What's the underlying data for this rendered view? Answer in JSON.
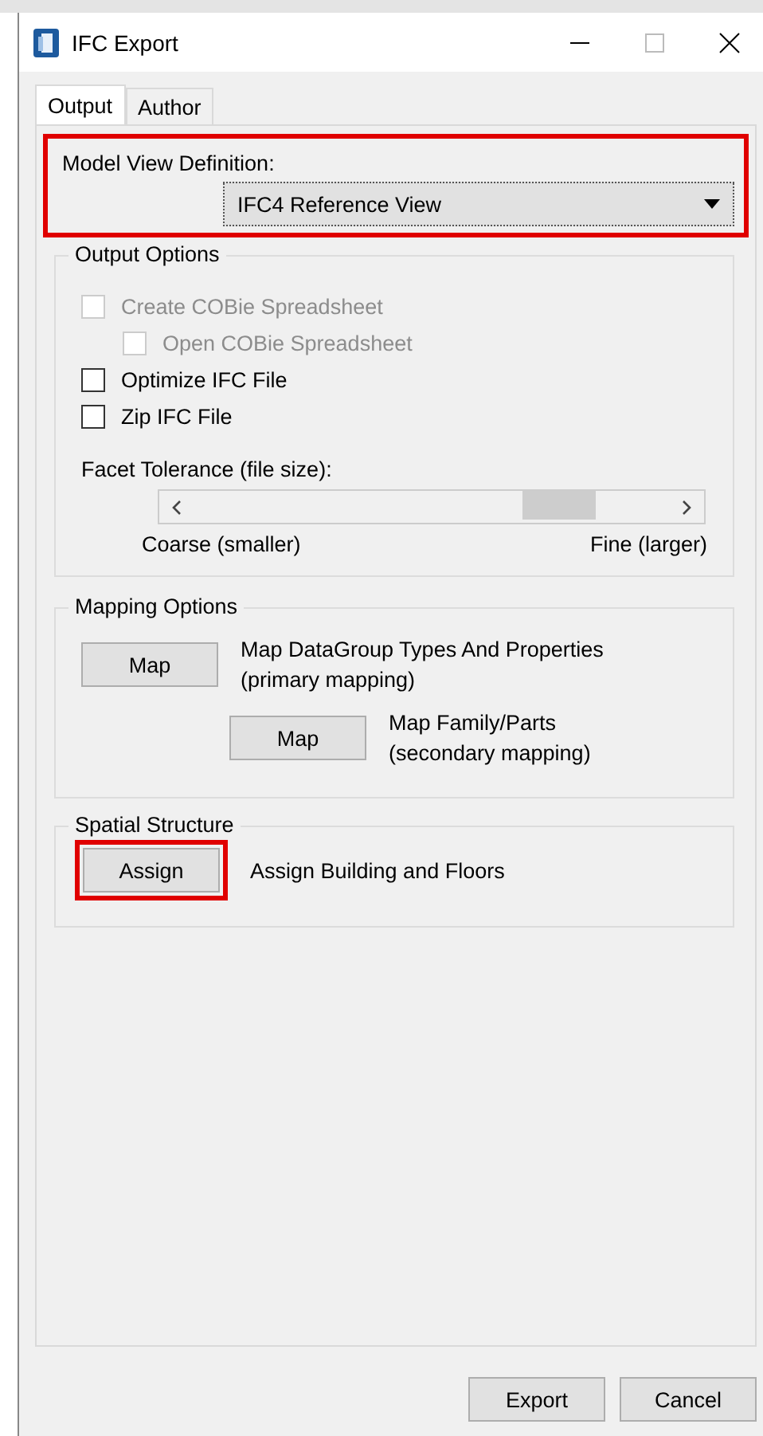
{
  "window": {
    "title": "IFC Export"
  },
  "tabs": [
    {
      "label": "Output",
      "selected": true
    },
    {
      "label": "Author",
      "selected": false
    }
  ],
  "model_view": {
    "label": "Model View Definition:",
    "value": "IFC4 Reference View",
    "highlighted": true
  },
  "output_options": {
    "title": "Output Options",
    "checkboxes": [
      {
        "label": "Create COBie Spreadsheet",
        "checked": false,
        "disabled": true,
        "indented": false
      },
      {
        "label": "Open COBie Spreadsheet",
        "checked": false,
        "disabled": true,
        "indented": true
      },
      {
        "label": "Optimize IFC File",
        "checked": false,
        "disabled": false,
        "indented": false
      },
      {
        "label": "Zip IFC File",
        "checked": false,
        "disabled": false,
        "indented": false
      }
    ],
    "facet": {
      "label": "Facet Tolerance (file size):",
      "level": 0.8,
      "min_label": "Coarse (smaller)",
      "max_label": "Fine (larger)"
    }
  },
  "mapping_options": {
    "title": "Mapping Options",
    "rows": [
      {
        "button": "Map",
        "text": "Map DataGroup Types And Properties",
        "subtext": "(primary mapping)",
        "indented": false
      },
      {
        "button": "Map",
        "text": "Map Family/Parts",
        "subtext": "(secondary mapping)",
        "indented": true
      }
    ]
  },
  "spatial_structure": {
    "title": "Spatial Structure",
    "button": "Assign",
    "text": "Assign Building and Floors",
    "highlighted": true
  },
  "buttons": [
    "Export",
    "Cancel"
  ]
}
